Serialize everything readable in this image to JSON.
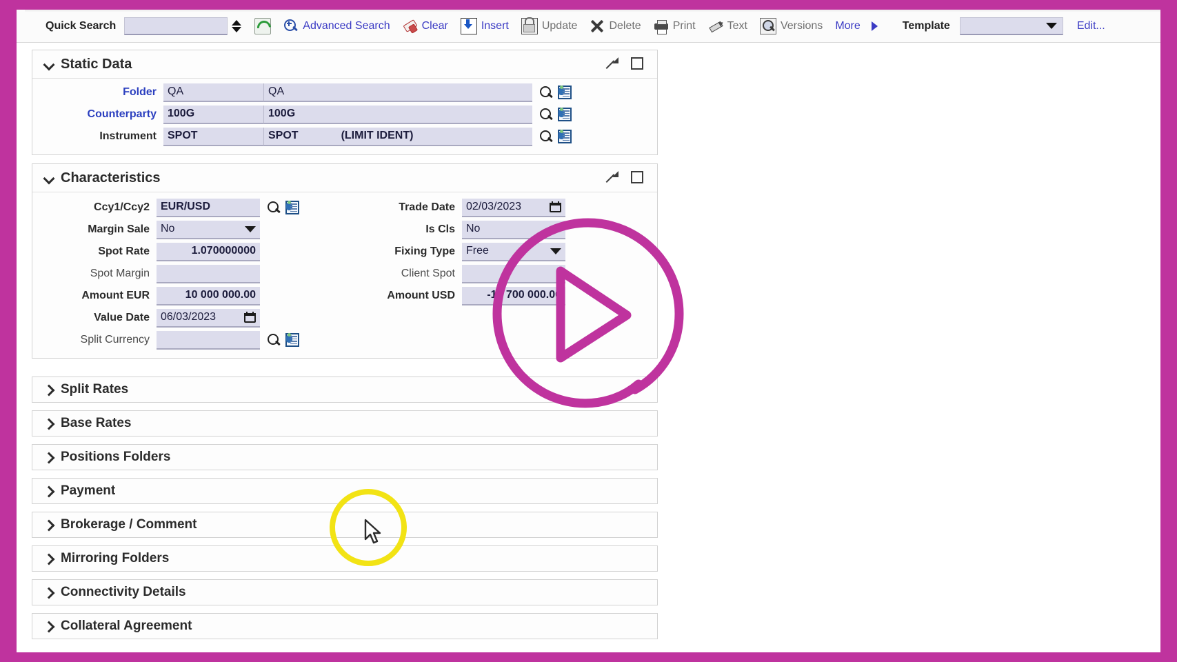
{
  "toolbar": {
    "quick_search_label": "Quick Search",
    "quick_search_value": "",
    "quick_search_placeholder": "",
    "buttons": [
      {
        "label": "Advanced Search",
        "icon": "zoom-search-icon",
        "style": "link"
      },
      {
        "label": "Clear",
        "icon": "eraser-icon",
        "style": "link"
      },
      {
        "label": "Insert",
        "icon": "insert-icon",
        "style": "link"
      },
      {
        "label": "Update",
        "icon": "update-lock-icon",
        "style": "disabled"
      },
      {
        "label": "Delete",
        "icon": "delete-x-icon",
        "style": "disabled"
      },
      {
        "label": "Print",
        "icon": "printer-icon",
        "style": "disabled"
      },
      {
        "label": "Text",
        "icon": "pencil-text-icon",
        "style": "disabled"
      },
      {
        "label": "Versions",
        "icon": "versions-magnifier-icon",
        "style": "disabled"
      }
    ],
    "more_label": "More",
    "refresh_icon": "refresh-icon",
    "template_label": "Template",
    "template_value": "",
    "edit_link": "Edit..."
  },
  "static_data": {
    "title": "Static Data",
    "rows": [
      {
        "label": "Folder",
        "code": "QA",
        "name": "QA",
        "extra": ""
      },
      {
        "label": "Counterparty",
        "code": "100G",
        "name": "100G",
        "extra": ""
      },
      {
        "label": "Instrument",
        "code": "SPOT",
        "name": "SPOT",
        "extra": "(LIMIT IDENT)"
      }
    ]
  },
  "characteristics": {
    "title": "Characteristics",
    "left_rows": [
      {
        "label": "Ccy1/Ccy2",
        "value": "EUR/USD",
        "type": "lookup"
      },
      {
        "label": "Margin Sale",
        "value": "No",
        "type": "select"
      },
      {
        "label": "Spot Rate",
        "value": "1.070000000",
        "type": "number"
      },
      {
        "label": "Spot Margin",
        "value": "",
        "type": "number"
      },
      {
        "label": "Amount EUR",
        "value": "10 000 000.00",
        "type": "number"
      },
      {
        "label": "Value Date",
        "value": "06/03/2023",
        "type": "date"
      },
      {
        "label": "Split Currency",
        "value": "",
        "type": "lookup"
      }
    ],
    "right_rows": [
      {
        "label": "Trade Date",
        "value": "02/03/2023",
        "type": "date"
      },
      {
        "label": "Is Cls",
        "value": "No",
        "type": "select"
      },
      {
        "label": "Fixing Type",
        "value": "Free",
        "type": "select"
      },
      {
        "label": "Client Spot",
        "value": "",
        "type": "text"
      },
      {
        "label": "Amount USD",
        "value": "-10 700 000.00",
        "type": "number"
      }
    ]
  },
  "sections": [
    {
      "title": "Split Rates"
    },
    {
      "title": "Base Rates"
    },
    {
      "title": "Positions Folders"
    },
    {
      "title": "Payment"
    },
    {
      "title": "Brokerage / Comment"
    },
    {
      "title": "Mirroring Folders"
    },
    {
      "title": "Connectivity Details"
    },
    {
      "title": "Collateral Agreement"
    }
  ],
  "overlay": {
    "play_button": "play-overlay-icon",
    "cursor_highlight": "cursor-highlight-circle",
    "cursor": "mouse-pointer",
    "accent_magenta": "#bf339e",
    "accent_yellow": "#f2e314"
  }
}
